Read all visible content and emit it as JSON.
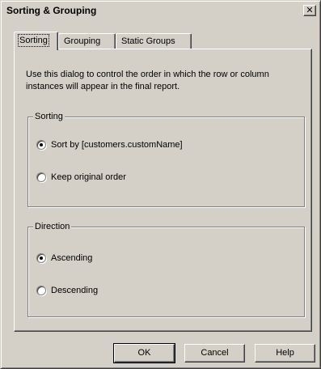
{
  "window": {
    "title": "Sorting & Grouping",
    "close_glyph": "✕"
  },
  "tabs": [
    {
      "label": "Sorting",
      "active": true
    },
    {
      "label": "Grouping",
      "active": false
    },
    {
      "label": "Static Groups",
      "active": false
    }
  ],
  "panel": {
    "description": "Use this dialog to control the order in which the row or column instances will appear in the final report.",
    "sorting_group": {
      "label": "Sorting",
      "options": [
        {
          "label": "Sort by [customers.customName]",
          "checked": true
        },
        {
          "label": "Keep original order",
          "checked": false
        }
      ]
    },
    "direction_group": {
      "label": "Direction",
      "options": [
        {
          "label": "Ascending",
          "checked": true
        },
        {
          "label": "Descending",
          "checked": false
        }
      ]
    }
  },
  "buttons": {
    "ok": "OK",
    "cancel": "Cancel",
    "help": "Help"
  }
}
